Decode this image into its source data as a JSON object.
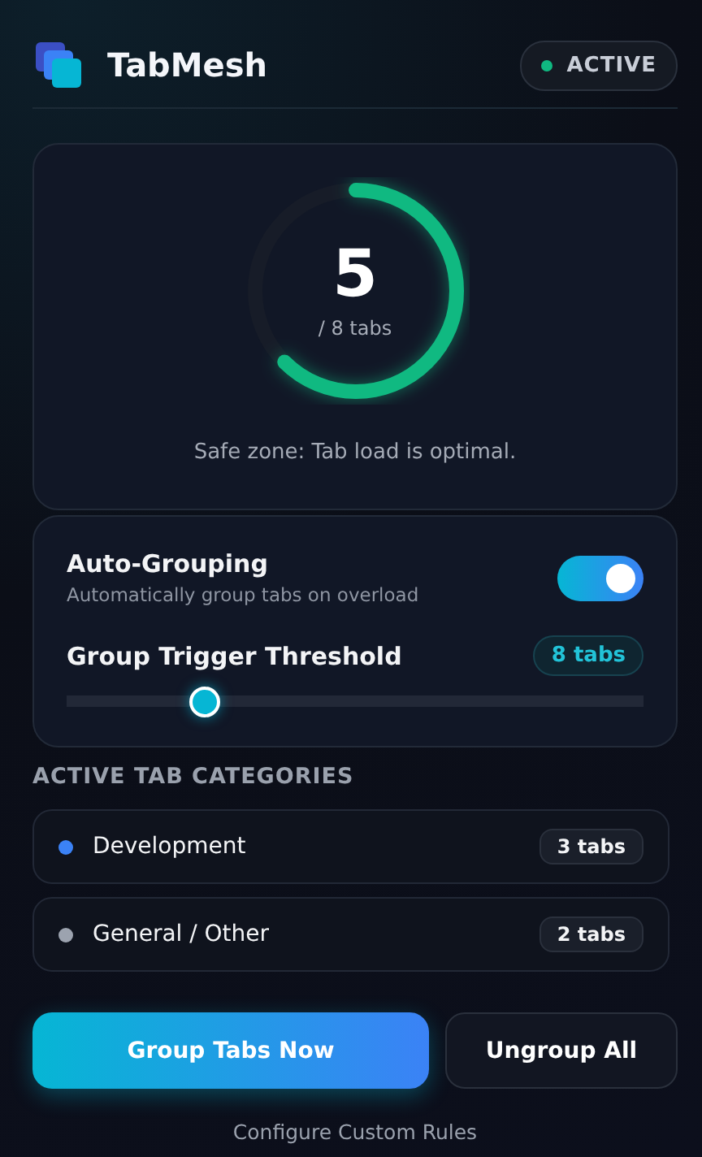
{
  "header": {
    "title": "TabMesh",
    "status": {
      "label": "ACTIVE",
      "on": true
    }
  },
  "gauge": {
    "value": "5",
    "caption": "/ 8 tabs",
    "message": "Safe zone: Tab load is optimal."
  },
  "settings": {
    "auto_grouping": {
      "label": "Auto-Grouping",
      "description": "Automatically group tabs on overload",
      "on": true
    },
    "threshold": {
      "label": "Group Trigger Threshold",
      "badge": "8 tabs",
      "level": 0.24
    }
  },
  "categories": {
    "heading": "ACTIVE TAB CATEGORIES",
    "items": [
      {
        "name": "Development",
        "count": "3 tabs",
        "color": "#3b82f6"
      },
      {
        "name": "General / Other",
        "count": "2 tabs",
        "color": "#9ca3af"
      }
    ]
  },
  "actions": [
    {
      "label": "Group Tabs Now",
      "kind": "primary"
    },
    {
      "label": "Ungroup All",
      "kind": "secondary"
    }
  ],
  "footer_link": "Configure Custom Rules"
}
